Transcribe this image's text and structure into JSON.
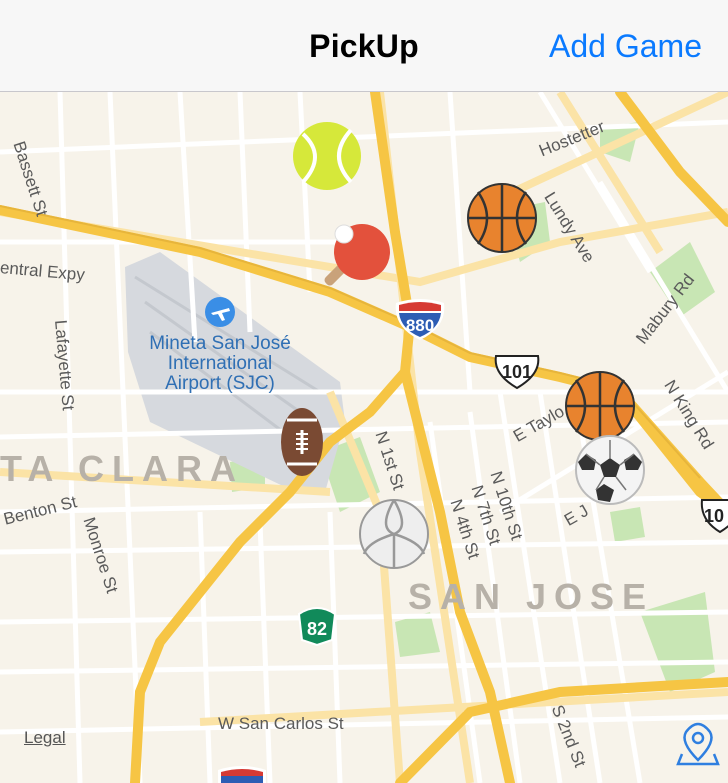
{
  "navbar": {
    "title": "PickUp",
    "action_label": "Add Game"
  },
  "map": {
    "city_labels": {
      "santa_clara": "TA CLARA",
      "san_jose": "SAN JOSE"
    },
    "airport": {
      "name": "Mineta San José International Airport (SJC)"
    },
    "streets": {
      "bassett": "Bassett St",
      "hostetter": "Hostetter",
      "lundy": "Lundy Ave",
      "central": "entral Expy",
      "lafayette": "Lafayette St",
      "mabury": "Mabury Rd",
      "nking": "N King Rd",
      "etaylor": "E Taylo",
      "ej": "E J",
      "n1st": "N 1st St",
      "n10th": "N 10th St",
      "n7th": "N 7th St",
      "n4th": "N 4th St",
      "benton": "Benton St",
      "monroe": "Monroe St",
      "wsancarlos": "W San Carlos St",
      "s2nd": "S 2nd St"
    },
    "shields": {
      "i880": "880",
      "us101": "101",
      "sr82": "82",
      "right101": "10"
    },
    "legal": "Legal",
    "pins": [
      {
        "sport": "tennis",
        "icon": "tennis-ball-icon"
      },
      {
        "sport": "ping pong",
        "icon": "ping-pong-paddle-icon"
      },
      {
        "sport": "basketball",
        "icon": "basketball-icon"
      },
      {
        "sport": "basketball",
        "icon": "basketball-icon"
      },
      {
        "sport": "soccer",
        "icon": "soccer-ball-icon"
      },
      {
        "sport": "football",
        "icon": "football-icon"
      },
      {
        "sport": "volleyball",
        "icon": "volleyball-icon"
      }
    ]
  },
  "colors": {
    "accent": "#0a7aff",
    "freeway": "#f6c544",
    "park": "#c8e6b4",
    "airport": "#d6d9de",
    "land": "#f7f3ea"
  }
}
